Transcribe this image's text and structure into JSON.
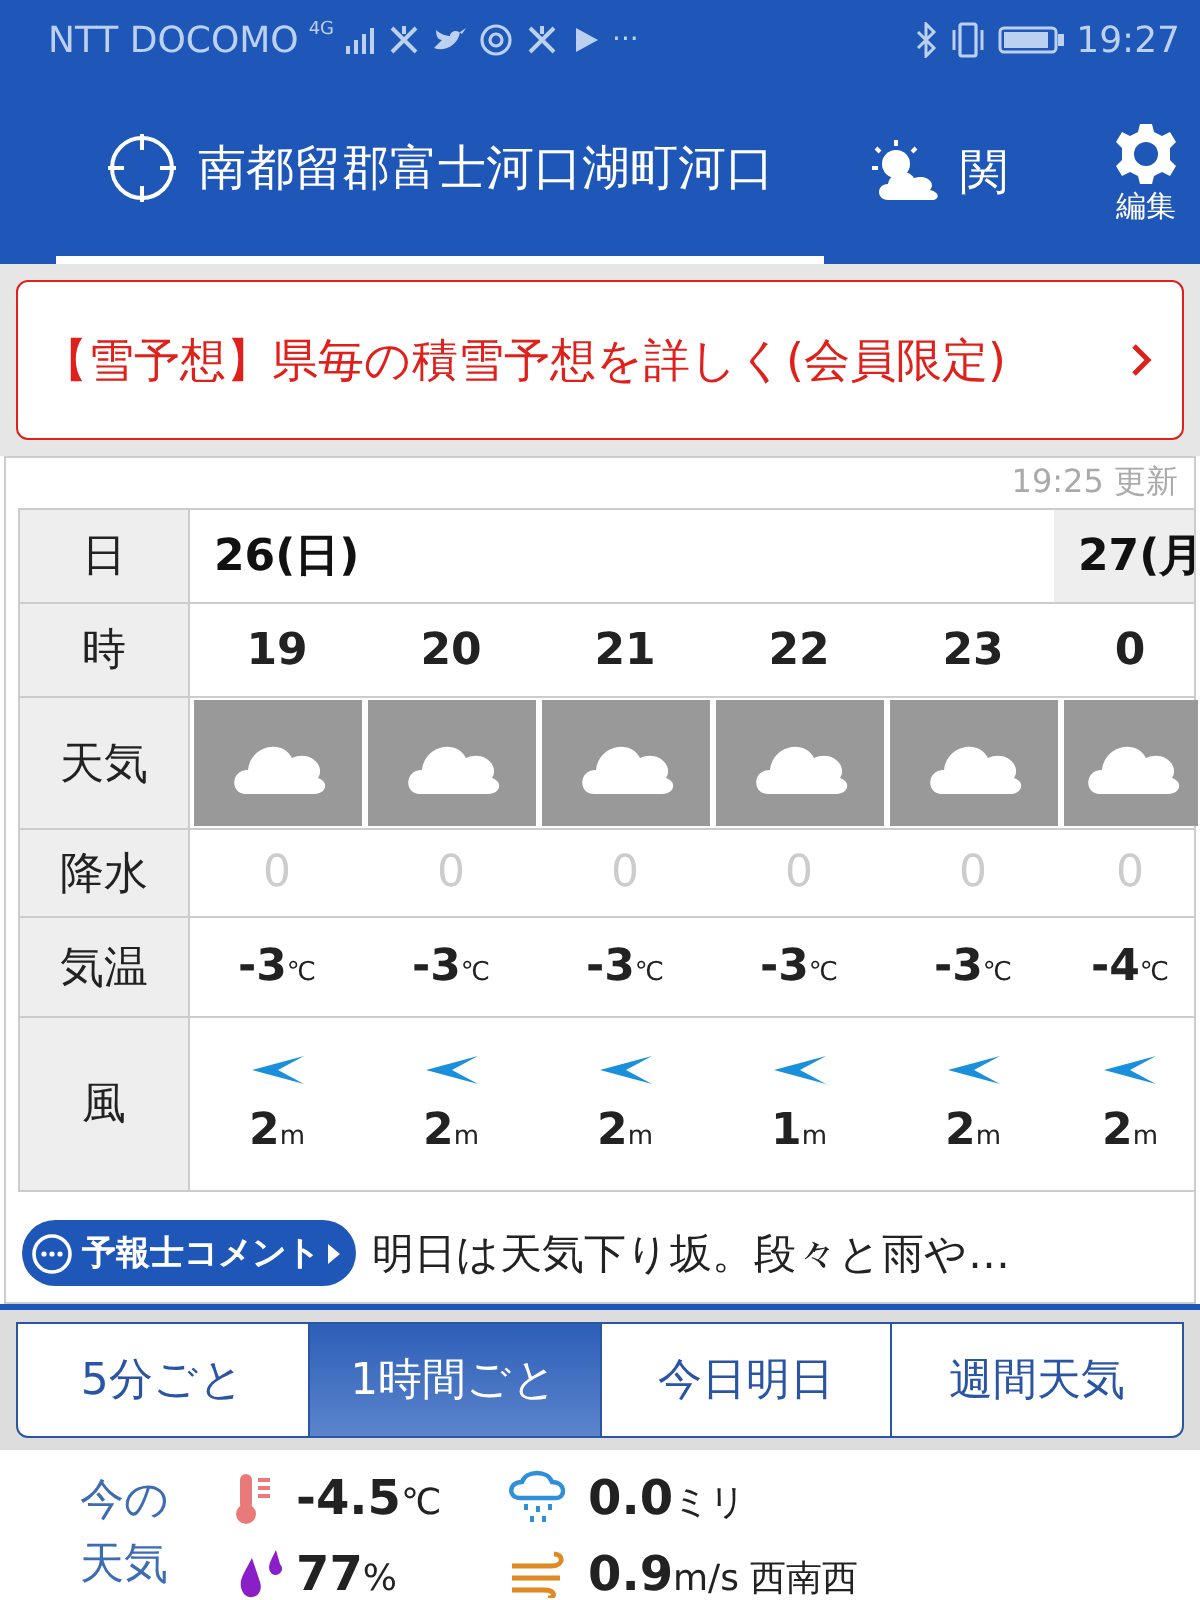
{
  "status_bar": {
    "carrier": "NTT DOCOMO",
    "network": "4G",
    "more": "···",
    "time": "19:27"
  },
  "header": {
    "location": "南都留郡富士河口湖町河口",
    "location_selected": true,
    "region": "関",
    "settings_label": "編集"
  },
  "banner": {
    "text": "【雪予想】県毎の積雪予想を詳しく(会員限定)"
  },
  "forecast": {
    "updated": "19:25 更新",
    "row_labels": {
      "day": "日",
      "hour": "時",
      "weather": "天気",
      "precip": "降水",
      "temp": "気温",
      "wind": "風"
    },
    "days": [
      {
        "label": "26(日)",
        "selected": true
      },
      {
        "label": "27(月",
        "selected": false
      }
    ],
    "hours": [
      {
        "hour": "19",
        "kind": "cloudy",
        "precip": "0",
        "temp": "-3",
        "temp_unit": "℃",
        "wind": "2",
        "wind_unit": "m"
      },
      {
        "hour": "20",
        "kind": "cloudy",
        "precip": "0",
        "temp": "-3",
        "temp_unit": "℃",
        "wind": "2",
        "wind_unit": "m"
      },
      {
        "hour": "21",
        "kind": "cloudy",
        "precip": "0",
        "temp": "-3",
        "temp_unit": "℃",
        "wind": "2",
        "wind_unit": "m"
      },
      {
        "hour": "22",
        "kind": "cloudy",
        "precip": "0",
        "temp": "-3",
        "temp_unit": "℃",
        "wind": "1",
        "wind_unit": "m"
      },
      {
        "hour": "23",
        "kind": "cloudy",
        "precip": "0",
        "temp": "-3",
        "temp_unit": "℃",
        "wind": "2",
        "wind_unit": "m"
      },
      {
        "hour": "0",
        "kind": "cloudy",
        "precip": "0",
        "temp": "-4",
        "temp_unit": "℃",
        "wind": "2",
        "wind_unit": "m"
      }
    ],
    "comment_button": "予報士コメント",
    "comment": "明日は天気下り坂。段々と雨や…"
  },
  "tabs": [
    {
      "label": "5分ごと",
      "selected": false
    },
    {
      "label": "1時間ごと",
      "selected": true
    },
    {
      "label": "今日明日",
      "selected": false
    },
    {
      "label": "週間天気",
      "selected": false
    }
  ],
  "current": {
    "label": "今の天気",
    "temp": "-4.5",
    "temp_unit": "℃",
    "precip": "0.0",
    "precip_unit": "ミリ",
    "humidity": "77",
    "humidity_unit": "%",
    "wind": "0.9",
    "wind_unit": "m/s",
    "wind_dir": "西南西"
  }
}
